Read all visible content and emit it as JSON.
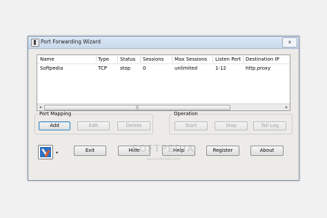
{
  "window": {
    "title": "Port Forwarding Wizard",
    "close_glyph": "x"
  },
  "list": {
    "columns": [
      "Name",
      "Type",
      "Status",
      "Sessions",
      "Max Sessions",
      "Listen Port",
      "Destination IP"
    ],
    "rows": [
      [
        "Softpedia",
        "TCP",
        "stop",
        "0",
        "unlimited",
        "1-12",
        "http.proxy"
      ]
    ],
    "scroll_left_glyph": "◂",
    "scroll_right_glyph": "▸",
    "scroll_grip": "|||"
  },
  "port_mapping": {
    "label": "Port Mapping",
    "add": "Add",
    "edit": "Edit",
    "delete": "Delete"
  },
  "operation": {
    "label": "Operation",
    "start": "Start",
    "stop": "Stop",
    "tail_log": "Tail Log"
  },
  "bottom": {
    "exit": "Exit",
    "hide": "Hide",
    "help": "Help",
    "register": "Register",
    "about": "About",
    "menu_arrow": "▾"
  },
  "watermark": {
    "main": "SOFTPEDIA",
    "sub": "www.softpedia.com"
  }
}
